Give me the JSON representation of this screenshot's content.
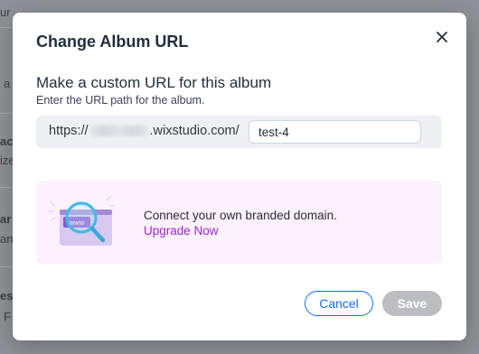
{
  "background": {
    "fragments": [
      "ur Settin",
      "a",
      "ac",
      "ize",
      "ar",
      "an",
      "es",
      "F"
    ]
  },
  "modal": {
    "title": "Change Album URL",
    "section_title": "Make a custom URL for this album",
    "section_subtitle": "Enter the URL path for the album.",
    "url_prefix_start": "https://",
    "url_prefix_end": ".wixstudio.com/",
    "slug_value": "test-4",
    "promo": {
      "illustration_label": "www",
      "text": "Connect your own branded domain.",
      "link": "Upgrade Now"
    },
    "buttons": {
      "cancel": "Cancel",
      "save": "Save"
    }
  },
  "colors": {
    "accent": "#116dff",
    "link_purple": "#9a27d5",
    "promo_bg": "#fdf1fd",
    "disabled": "#bcbdc0"
  }
}
